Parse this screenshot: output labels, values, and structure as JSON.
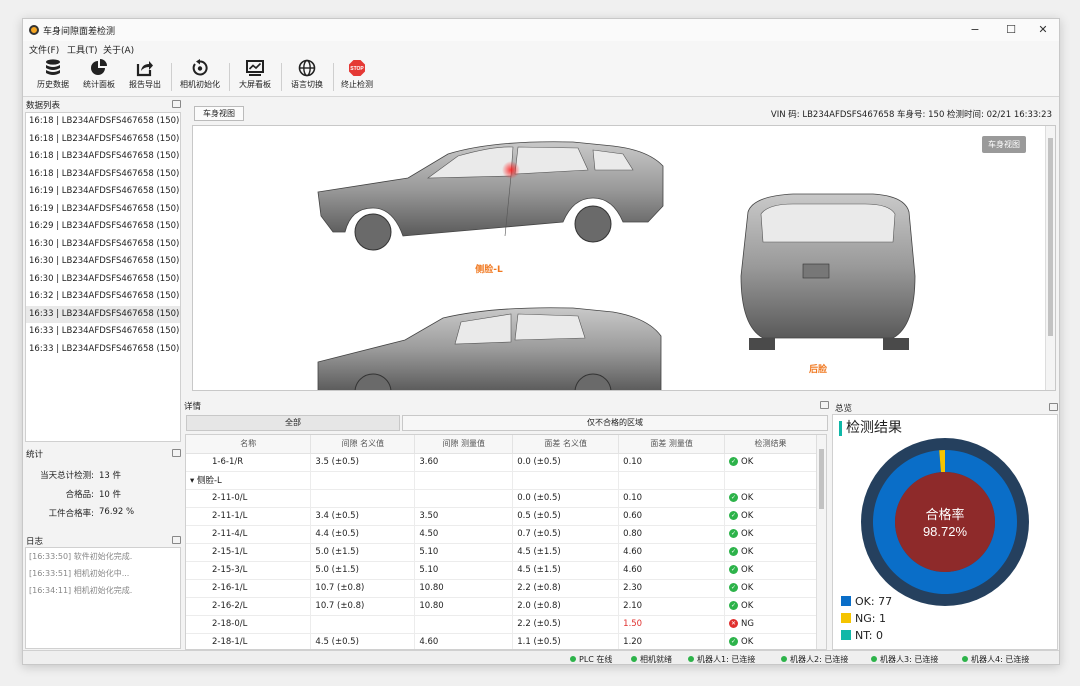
{
  "window": {
    "title": "车身间隙面差检测"
  },
  "menu": [
    "文件(F)",
    "工具(T)",
    "关于(A)"
  ],
  "toolbar": [
    {
      "label": "历史数据",
      "icon": "database-icon"
    },
    {
      "label": "统计面板",
      "icon": "pie-chart-icon"
    },
    {
      "label": "报告导出",
      "icon": "export-icon"
    },
    {
      "label": "相机初始化",
      "icon": "camera-reset-icon"
    },
    {
      "label": "大屏看板",
      "icon": "monitor-icon"
    },
    {
      "label": "语言切换",
      "icon": "globe-icon"
    },
    {
      "label": "终止检测",
      "icon": "stop-icon",
      "badge": "STOP"
    }
  ],
  "data_list": {
    "title": "数据列表",
    "items": [
      "16:18 | LB234AFDSFS467658 (150)",
      "16:18 | LB234AFDSFS467658 (150)",
      "16:18 | LB234AFDSFS467658 (150)",
      "16:18 | LB234AFDSFS467658 (150)",
      "16:19 | LB234AFDSFS467658 (150)",
      "16:19 | LB234AFDSFS467658 (150)",
      "16:29 | LB234AFDSFS467658 (150)",
      "16:30 | LB234AFDSFS467658 (150)",
      "16:30 | LB234AFDSFS467658 (150)",
      "16:30 | LB234AFDSFS467658 (150)",
      "16:32 | LB234AFDSFS467658 (150)",
      "16:33 | LB234AFDSFS467658 (150)",
      "16:33 | LB234AFDSFS467658 (150)",
      "16:33 | LB234AFDSFS467658 (150)"
    ],
    "selected_index": 11
  },
  "stats": {
    "title": "统计",
    "total_label": "当天总计检测:",
    "total_value": "13 件",
    "pass_label": "合格品:",
    "pass_value": "10 件",
    "rate_label": "工件合格率:",
    "rate_value": "76.92 %"
  },
  "log": {
    "title": "日志",
    "lines": [
      "[16:33:50] 软件初始化完成.",
      "[16:33:51] 相机初始化中...",
      "[16:34:11] 相机初始化完成."
    ]
  },
  "viewer": {
    "tab_label": "车身视图",
    "button_label": "车身视图",
    "vin_info": "VIN 码: LB234AFDSFS467658  车身号: 150  检测时间: 02/21 16:33:23",
    "label_side": "侧脸-L",
    "label_rear": "后脸"
  },
  "details": {
    "title": "详情",
    "filter_all": "全部",
    "filter_ng": "仅不合格的区域",
    "columns": [
      "名称",
      "间隙 名义值",
      "间隙 测量值",
      "面差 名义值",
      "面差 测量值",
      "检测结果"
    ],
    "group_label": "侧脸-L",
    "rows": [
      {
        "name": "1-6-1/R",
        "gap_nom": "3.5 (±0.5)",
        "gap_meas": "3.60",
        "flush_nom": "0.0 (±0.5)",
        "flush_meas": "0.10",
        "result": "OK"
      },
      {
        "name": "2-11-0/L",
        "gap_nom": "",
        "gap_meas": "",
        "flush_nom": "0.0 (±0.5)",
        "flush_meas": "0.10",
        "result": "OK"
      },
      {
        "name": "2-11-1/L",
        "gap_nom": "3.4 (±0.5)",
        "gap_meas": "3.50",
        "flush_nom": "0.5 (±0.5)",
        "flush_meas": "0.60",
        "result": "OK"
      },
      {
        "name": "2-11-4/L",
        "gap_nom": "4.4 (±0.5)",
        "gap_meas": "4.50",
        "flush_nom": "0.7 (±0.5)",
        "flush_meas": "0.80",
        "result": "OK"
      },
      {
        "name": "2-15-1/L",
        "gap_nom": "5.0 (±1.5)",
        "gap_meas": "5.10",
        "flush_nom": "4.5 (±1.5)",
        "flush_meas": "4.60",
        "result": "OK"
      },
      {
        "name": "2-15-3/L",
        "gap_nom": "5.0 (±1.5)",
        "gap_meas": "5.10",
        "flush_nom": "4.5 (±1.5)",
        "flush_meas": "4.60",
        "result": "OK"
      },
      {
        "name": "2-16-1/L",
        "gap_nom": "10.7 (±0.8)",
        "gap_meas": "10.80",
        "flush_nom": "2.2 (±0.8)",
        "flush_meas": "2.30",
        "result": "OK"
      },
      {
        "name": "2-16-2/L",
        "gap_nom": "10.7 (±0.8)",
        "gap_meas": "10.80",
        "flush_nom": "2.0 (±0.8)",
        "flush_meas": "2.10",
        "result": "OK"
      },
      {
        "name": "2-18-0/L",
        "gap_nom": "",
        "gap_meas": "",
        "flush_nom": "2.2 (±0.5)",
        "flush_meas": "1.50",
        "result": "NG"
      },
      {
        "name": "2-18-1/L",
        "gap_nom": "4.5 (±0.5)",
        "gap_meas": "4.60",
        "flush_nom": "1.1 (±0.5)",
        "flush_meas": "1.20",
        "result": "OK"
      }
    ]
  },
  "summary": {
    "panel_title": "总览",
    "title": "检测结果",
    "center_label": "合格率",
    "center_value": "98.72%",
    "legend": [
      {
        "label": "OK: 77",
        "color": "#0a6ec8"
      },
      {
        "label": "NG: 1",
        "color": "#f5c400"
      },
      {
        "label": "NT: 0",
        "color": "#10b8a8"
      }
    ]
  },
  "chart_data": {
    "type": "pie",
    "title": "检测结果",
    "categories": [
      "OK",
      "NG",
      "NT"
    ],
    "values": [
      77,
      1,
      0
    ],
    "center_text": "合格率 98.72%"
  },
  "statusbar": [
    "PLC 在线",
    "相机就绪",
    "机器人1: 已连接",
    "机器人2: 已连接",
    "机器人3: 已连接",
    "机器人4: 已连接"
  ],
  "colors": {
    "ok": "#2db34a",
    "ng": "#e0302e",
    "accent_orange": "#f07820"
  }
}
